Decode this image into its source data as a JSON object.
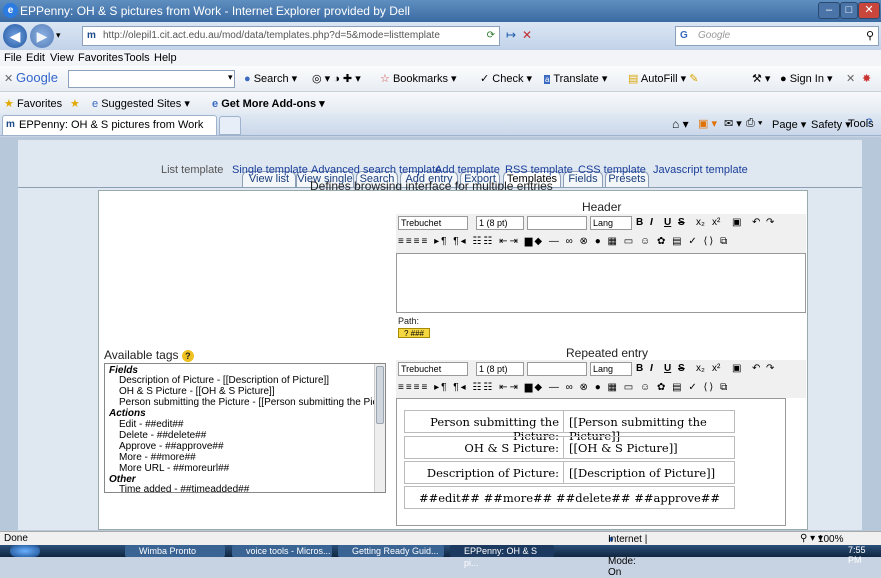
{
  "window": {
    "title": "EPPenny: OH & S pictures from Work - Internet Explorer provided by Dell"
  },
  "address_bar": {
    "url": "http://olepil1.cit.act.edu.au/mod/data/templates.php?d=5&mode=listtemplate",
    "search_placeholder": "Google"
  },
  "menu": [
    "File",
    "Edit",
    "View",
    "Favorites",
    "Tools",
    "Help"
  ],
  "google_toolbar": {
    "brand": "Google",
    "search": "Search",
    "bookmarks": "Bookmarks",
    "check": "Check",
    "translate": "Translate",
    "autofill": "AutoFill",
    "sign_in": "Sign In"
  },
  "favorites_bar": {
    "favorites": "Favorites",
    "suggested": "Suggested Sites",
    "addons": "Get More Add-ons"
  },
  "browser_tab": {
    "title": "EPPenny: OH & S pictures from Work"
  },
  "command_bar": {
    "page": "Page",
    "safety": "Safety",
    "tools": "Tools"
  },
  "tabs": [
    "View list",
    "View single",
    "Search",
    "Add entry",
    "Export",
    "Templates",
    "Fields",
    "Presets"
  ],
  "subtabs": [
    "List template",
    "Single template",
    "Advanced search template",
    "Add template",
    "RSS template",
    "CSS template",
    "Javascript template"
  ],
  "description": "Defines browsing interface for multiple entries",
  "header_label": "Header",
  "editor": {
    "font": "Trebuchet",
    "size": "1 (8 pt)",
    "lang": "Lang",
    "path_label": "Path:"
  },
  "available_tags_label": "Available tags",
  "tags": [
    {
      "text": "Fields",
      "group": true
    },
    {
      "text": "Description of Picture - [[Description of Picture]]",
      "group": false
    },
    {
      "text": "OH & S Picture - [[OH & S Picture]]",
      "group": false
    },
    {
      "text": "Person submitting the Picture - [[Person submitting the Picture]]",
      "group": false
    },
    {
      "text": "Actions",
      "group": true
    },
    {
      "text": "Edit - ##edit##",
      "group": false
    },
    {
      "text": "Delete - ##delete##",
      "group": false
    },
    {
      "text": "Approve - ##approve##",
      "group": false
    },
    {
      "text": "More - ##more##",
      "group": false
    },
    {
      "text": "More URL - ##moreurl##",
      "group": false
    },
    {
      "text": "Other",
      "group": true
    },
    {
      "text": "Time added - ##timeadded##",
      "group": false
    }
  ],
  "repeated_entry_label": "Repeated entry",
  "repeated_rows": [
    {
      "label": "Person submitting the Picture:",
      "value": "[[Person submitting the Picture]]"
    },
    {
      "label": "OH & S Picture:",
      "value": "[[OH & S Picture]]"
    },
    {
      "label": "Description of Picture:",
      "value": "[[Description of Picture]]"
    }
  ],
  "actions_row": "##edit## ##more## ##delete## ##approve##",
  "status": {
    "left": "Done",
    "zone": "Internet | Protected Mode: On",
    "zoom": "100%"
  },
  "taskbar": [
    "Wimba Pronto",
    "voice tools - Micros...",
    "Getting Ready Guid...",
    "EPPenny: OH & S pi..."
  ],
  "clock": "7:55 PM"
}
